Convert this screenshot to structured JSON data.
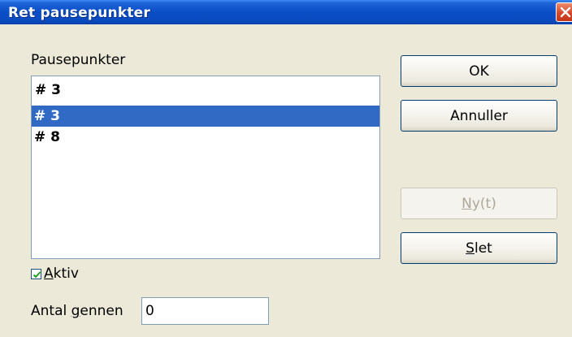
{
  "window": {
    "title": "Ret pausepunkter"
  },
  "breakpoints": {
    "label": "Pausepunkter",
    "current_value": "# 3",
    "items": [
      {
        "label": "# 3",
        "selected": true
      },
      {
        "label": "# 8",
        "selected": false
      }
    ]
  },
  "buttons": {
    "ok": "OK",
    "cancel": "Annuller",
    "new_mnemonic": "N",
    "new_rest": "y(t)",
    "delete_mnemonic": "S",
    "delete_rest": "let"
  },
  "active": {
    "mnemonic": "A",
    "rest": "ktiv",
    "checked": true
  },
  "pass_count": {
    "label_pre": "Antal ",
    "mnemonic": "g",
    "label_post": "ennen",
    "value": "0"
  },
  "colors": {
    "title_bar": "#0a4ec7",
    "selection": "#316ac5",
    "dialog_bg": "#ece9d8"
  }
}
